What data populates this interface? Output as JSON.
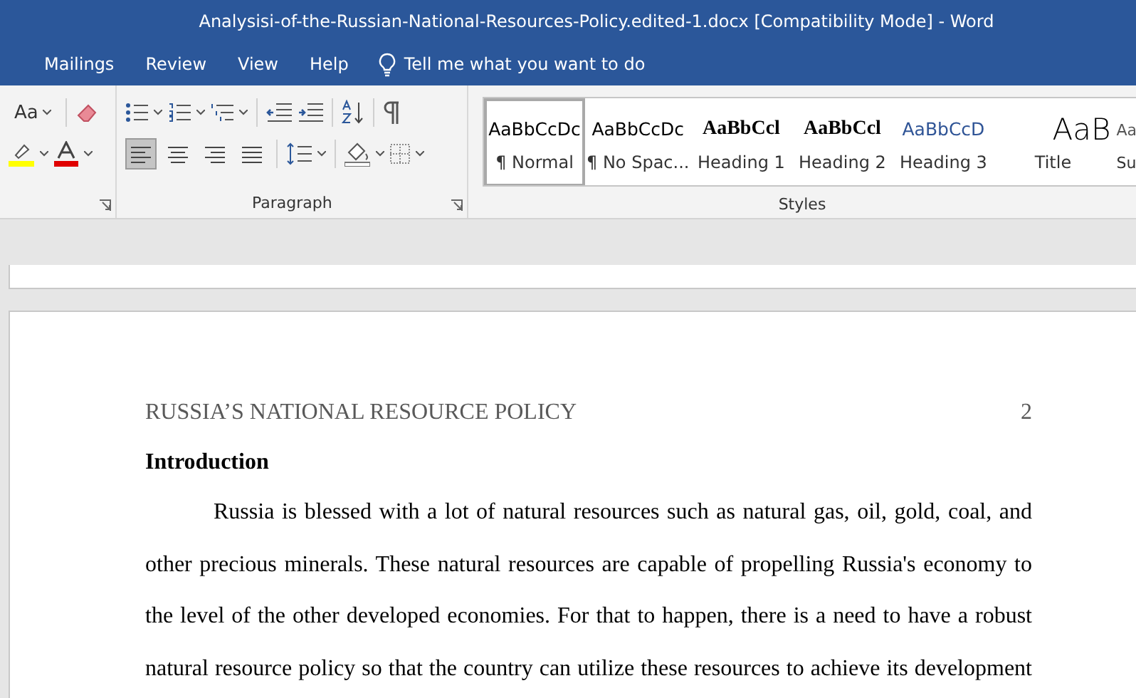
{
  "window": {
    "title": "Analysisi-of-the-Russian-National-Resources-Policy.edited-1.docx [Compatibility Mode]  -  Word"
  },
  "tabs": [
    {
      "label": "Mailings",
      "selected": false
    },
    {
      "label": "Review",
      "selected": false
    },
    {
      "label": "View",
      "selected": false
    },
    {
      "label": "Help",
      "selected": false
    }
  ],
  "tell_me": {
    "label": "Tell me what you want to do"
  },
  "font_group": {
    "change_case": "Aa"
  },
  "paragraph_group": {
    "label": "Paragraph",
    "alignment": [
      {
        "kind": "left",
        "selected": true
      },
      {
        "kind": "center",
        "selected": false
      },
      {
        "kind": "right",
        "selected": false
      },
      {
        "kind": "justify",
        "selected": false
      }
    ]
  },
  "styles_group": {
    "label": "Styles",
    "styles": [
      {
        "kind": "normal",
        "preview": "AaBbCcDc",
        "name": "¶ Normal",
        "selected": true
      },
      {
        "kind": "normal",
        "preview": "AaBbCcDc",
        "name": "¶ No Spac...",
        "selected": false
      },
      {
        "kind": "heading1",
        "preview": "AaBbCcl",
        "name": "Heading 1",
        "selected": false
      },
      {
        "kind": "heading2",
        "preview": "AaBbCcl",
        "name": "Heading 2",
        "selected": false
      },
      {
        "kind": "heading3",
        "preview": "AaBbCcD",
        "name": "Heading 3",
        "selected": false
      },
      {
        "kind": "title",
        "preview": "AaB",
        "name": "Title",
        "selected": false
      },
      {
        "kind": "subtitle",
        "preview": "Aa",
        "name": "Su",
        "selected": false
      }
    ]
  },
  "document": {
    "header": "RUSSIA’S NATIONAL RESOURCE POLICY",
    "page_number": "2",
    "heading": "Introduction",
    "paragraph": "Russia is blessed with a lot of natural resources such as natural gas, oil, gold, coal, and other precious minerals. These natural resources are capable of propelling Russia's economy to the level of the other developed economies. For that to happen, there is a need to have a robust natural resource policy so that the country can utilize these resources to achieve its development"
  }
}
